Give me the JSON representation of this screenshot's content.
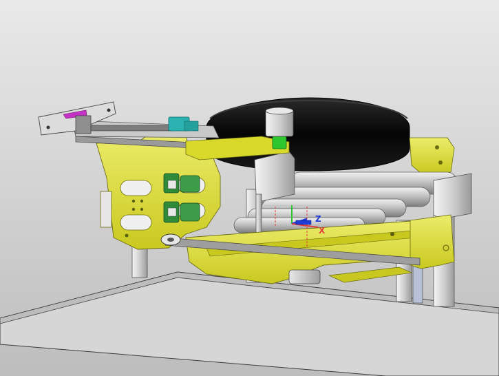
{
  "viewport": {
    "background_top": "#e9e9e9",
    "background_bottom": "#bdbdbd"
  },
  "colors": {
    "frame_yellow": "#d9d92b",
    "frame_yellow_dark": "#a8a81a",
    "frame_yellow_light": "#ecec6a",
    "roller_light": "#e4e4e4",
    "roller_mid": "#b3b3b3",
    "roller_dark": "#7d7d7d",
    "tire_black": "#0a0a0a",
    "rail_grey": "#8f8f8f",
    "floor_plate": "#dcdcdc",
    "motor_green": "#2f8a3a",
    "accent_cyan": "#2ab3b0",
    "accent_green": "#2ec62e",
    "accent_magenta": "#c531c5",
    "axis_x": "#e23b3b",
    "axis_y": "#2ec62e",
    "axis_z": "#1f3bd8"
  },
  "triad": {
    "z_label": "Z",
    "x_label": "X"
  }
}
